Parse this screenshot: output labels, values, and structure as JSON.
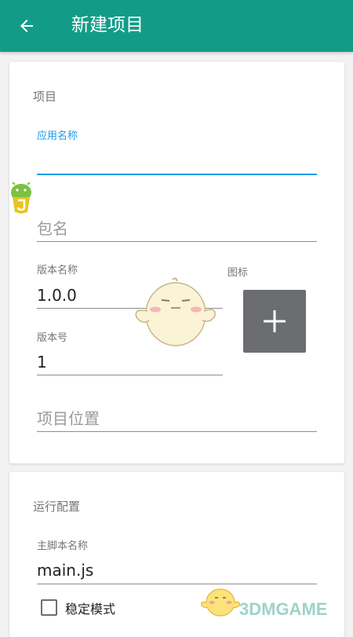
{
  "appbar": {
    "back_icon": "arrow-left-icon",
    "title": "新建项目",
    "color": "#129c87"
  },
  "project_section": {
    "title": "项目",
    "app_name": {
      "label": "应用名称",
      "value": "",
      "focused": true
    },
    "package_name": {
      "placeholder": "包名",
      "value": ""
    },
    "version_name": {
      "label": "版本名称",
      "value": "1.0.0"
    },
    "version_code": {
      "label": "版本号",
      "value": "1"
    },
    "icon": {
      "label": "图标",
      "button_icon": "plus-icon"
    },
    "location": {
      "placeholder": "项目位置",
      "value": ""
    }
  },
  "run_section": {
    "title": "运行配置",
    "main_script": {
      "label": "主脚本名称",
      "value": "main.js"
    },
    "stable_mode": {
      "label": "稳定模式",
      "checked": false
    }
  },
  "overlays": {
    "floating_logo_icon": "js-android-logo-icon",
    "watermark_mascot_icon": "chick-mascot-icon",
    "watermark_text": "3DMGAME"
  },
  "colors": {
    "accent": "#1e9be8",
    "icon_button": "#6b6d70"
  }
}
